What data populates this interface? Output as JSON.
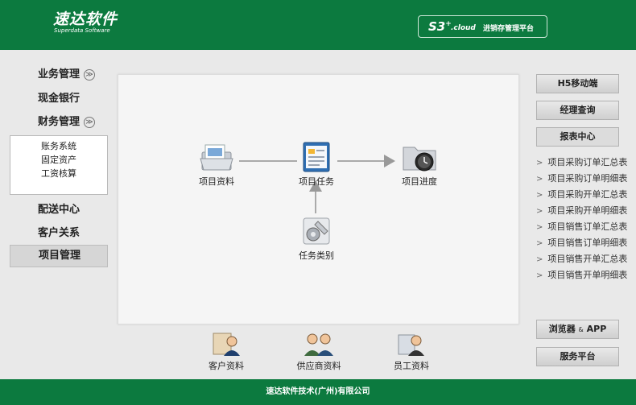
{
  "header": {
    "logo_cn": "速达软件",
    "logo_en": "Superdata Software",
    "brand_s3": "S3",
    "brand_plus": "+",
    "brand_cloud": ".cloud",
    "brand_sub": "进销存管理平台"
  },
  "left_menu": {
    "items": [
      {
        "label": "业务管理",
        "expand": "≫"
      },
      {
        "label": "现金银行"
      },
      {
        "label": "财务管理",
        "expand": "≫"
      },
      {
        "label": "配送中心"
      },
      {
        "label": "客户关系"
      },
      {
        "label": "项目管理"
      }
    ],
    "finance_sub": [
      "账务系统",
      "固定资产",
      "工资核算"
    ]
  },
  "flow": {
    "project_info": "项目资料",
    "project_task": "项目任务",
    "project_progress": "项目进度",
    "task_category": "任务类别"
  },
  "bottom": {
    "customer": "客户资料",
    "supplier": "供应商资料",
    "employee": "员工资料"
  },
  "right": {
    "h5": "H5移动端",
    "manager": "经理查询",
    "report_center": "报表中心",
    "reports": [
      "项目采购订单汇总表",
      "项目采购订单明细表",
      "项目采购开单汇总表",
      "项目采购开单明细表",
      "项目销售订单汇总表",
      "项目销售订单明细表",
      "项目销售开单汇总表",
      "项目销售开单明细表"
    ],
    "browser_a": "浏览器",
    "browser_amp": "&",
    "browser_b": "APP",
    "service": "服务平台"
  },
  "footer": {
    "company": "速达软件技术(广州)有限公司"
  }
}
